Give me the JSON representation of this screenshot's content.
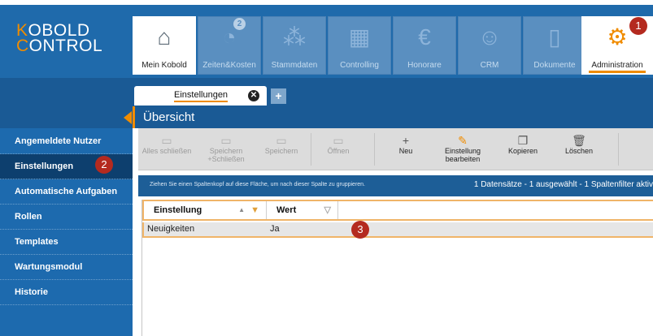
{
  "logo": {
    "line1_first": "K",
    "line1_rest": "OBOLD",
    "line2_first": "C",
    "line2_rest": "ONTROL"
  },
  "modules": [
    {
      "label": "Mein Kobold",
      "icon": "home-icon",
      "glyph": "⌂"
    },
    {
      "label": "Zeiten&Kosten",
      "icon": "stopwatch-icon",
      "glyph": "◔",
      "badge": "2"
    },
    {
      "label": "Stammdaten",
      "icon": "hierarchy-icon",
      "glyph": "⁂"
    },
    {
      "label": "Controlling",
      "icon": "calculator-icon",
      "glyph": "▦"
    },
    {
      "label": "Honorare",
      "icon": "coins-euro-icon",
      "glyph": "€"
    },
    {
      "label": "CRM",
      "icon": "people-icon",
      "glyph": "☺"
    },
    {
      "label": "Dokumente",
      "icon": "document-icon",
      "glyph": "▯"
    },
    {
      "label": "Administration",
      "icon": "gears-icon",
      "glyph": "⚙"
    }
  ],
  "markers": {
    "m1": "1",
    "m2": "2",
    "m3": "3"
  },
  "tabs": {
    "active_label": "Einstellungen",
    "close_glyph": "✕",
    "add_glyph": "+"
  },
  "sidebar": {
    "items": [
      {
        "label": "Angemeldete Nutzer"
      },
      {
        "label": "Einstellungen"
      },
      {
        "label": "Automatische Aufgaben"
      },
      {
        "label": "Rollen"
      },
      {
        "label": "Templates"
      },
      {
        "label": "Wartungsmodul"
      },
      {
        "label": "Historie"
      }
    ]
  },
  "main": {
    "title": "Übersicht"
  },
  "toolbar": {
    "buttons": [
      {
        "label": "Alles schließen",
        "glyph": "▭",
        "enabled": false
      },
      {
        "label": "Speichern +Schließen",
        "glyph": "▭",
        "enabled": false
      },
      {
        "label": "Speichern",
        "glyph": "▭",
        "enabled": false
      },
      {
        "label": "Öffnen",
        "glyph": "▭",
        "enabled": false
      },
      {
        "label": "Neu",
        "glyph": "+",
        "enabled": true
      },
      {
        "label": "Einstellung bearbeiten",
        "glyph": "✎",
        "enabled": true
      },
      {
        "label": "Kopieren",
        "glyph": "❐",
        "enabled": true
      },
      {
        "label": "Löschen",
        "glyph": "🗑",
        "enabled": true
      }
    ]
  },
  "grid": {
    "group_hint": "Ziehen Sie einen Spaltenkopf auf diese Fläche, um nach dieser Spalte zu gruppieren.",
    "status": "1 Datensätze - 1 ausgewählt - 1 Spaltenfilter aktiv",
    "columns": [
      {
        "label": "Einstellung",
        "sort_glyph": "▲",
        "filter_glyph": "▼"
      },
      {
        "label": "Wert",
        "filter_glyph": "▽"
      }
    ],
    "rows": [
      {
        "einstellung": "Neuigkeiten",
        "wert": "Ja"
      }
    ]
  },
  "colors": {
    "accent": "#f08c00",
    "header_blue": "#1f6aab",
    "sidebar_blue": "#1d6aae",
    "marker_red": "#b42a1f"
  }
}
